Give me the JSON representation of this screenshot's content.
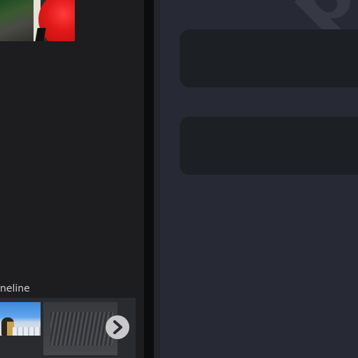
{
  "left_panel": {
    "timeline_label": "neline"
  },
  "right_panel": {
    "watermark_text": "par"
  },
  "icons": {
    "next": "chevron-right-icon"
  },
  "colors": {
    "left_bg": "#1d1d1f",
    "right_bg": "#272a34",
    "card_bg": "#1c1f24",
    "next_button_bg": "#c9c9cb"
  }
}
